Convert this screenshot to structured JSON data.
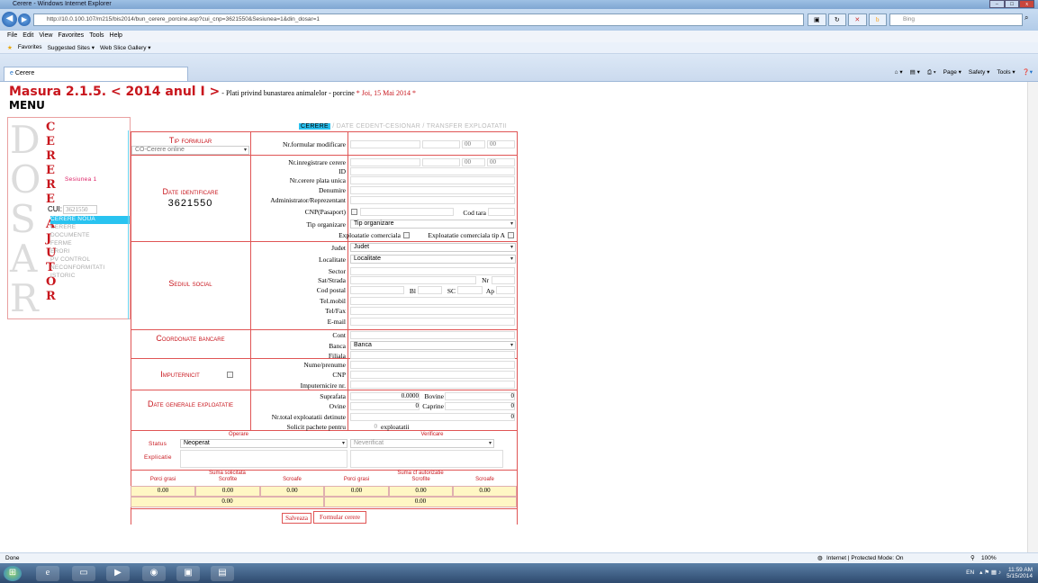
{
  "window": {
    "title": "Cerere - Windows Internet Explorer",
    "url": "http://10.0.100.107/m215/bis2014/bun_cerere_porcine.asp?cui_cnp=3621550&Sesiunea=1&din_dosar=1",
    "search_placeholder": "Bing"
  },
  "menubar": [
    "File",
    "Edit",
    "View",
    "Favorites",
    "Tools",
    "Help"
  ],
  "favbar": {
    "favorites": "Favorites",
    "suggested": "Suggested Sites ▾",
    "gallery": "Web Slice Gallery ▾"
  },
  "tab": {
    "label": "Cerere"
  },
  "cmdbar": [
    "Page ▾",
    "Safety ▾",
    "Tools ▾"
  ],
  "heading": {
    "title": "Masura 2.1.5. < 2014 anul I >",
    "subtitle": " - Plati privind bunastarea animalelor - porcine",
    "date": " * Joi, 15 Mai 2014 *"
  },
  "menu_label": "MENU",
  "sidebar": {
    "big_letters": [
      "D",
      "O",
      "S",
      "A",
      "R"
    ],
    "red_letters": [
      "C",
      "E",
      "R",
      "E",
      "R",
      "E",
      "A",
      "J",
      "U",
      "T",
      "O",
      "R"
    ],
    "session": "Sesiunea 1",
    "cui_label": "CUI:",
    "cui_value": "3621550",
    "items": [
      "CERERE NOUA",
      "CERERE",
      "DOCUMENTE",
      "FERME",
      "ERORI",
      "PV CONTROL",
      "NECONFORMITATI",
      "ISTORIC"
    ]
  },
  "tabs": {
    "active": "CERERE",
    "rest": " / DATE CEDENT-CESIONAR / TRANSFER EXPLOATATII"
  },
  "sections": {
    "tip_formular": "Tip formular",
    "date_identificare": "Date identificare",
    "cui": "3621550",
    "sediul": "Sediul social",
    "coordonate": "Coordonate bancare",
    "imputernicit": "Imputernicit",
    "date_generale": "Date generale exploatatie"
  },
  "tip_formular_value": "CO-Cerere online",
  "labels": {
    "nr_formular": "Nr.formular modificare",
    "nr_inreg": "Nr.inregistrare cerere",
    "id": "ID",
    "nr_plata": "Nr.cerere plata unica",
    "denumire": "Denumire",
    "admin": "Administrator/Reprezentant",
    "cnp_pasaport": "CNP(Pasaport)",
    "cod_tara": "Cod tara",
    "tip_org": "Tip organizare",
    "expl_com": "Exploatatie comerciala",
    "expl_com_a": "Exploatatie comerciala tip A",
    "judet": "Judet",
    "localitate": "Localitate",
    "sector": "Sector",
    "sat": "Sat/Strada",
    "nr": "Nr",
    "cod_postal": "Cod postal",
    "bl": "Bl",
    "sc": "SC",
    "ap": "Ap",
    "tel_mobil": "Tel.mobil",
    "tel_fax": "Tel/Fax",
    "email": "E-mail",
    "cont": "Cont",
    "banca": "Banca",
    "filiala": "Filiala",
    "nume": "Nume/prenume",
    "cnp": "CNP",
    "imp_nr": "Imputernicire nr.",
    "suprafata": "Suprafata",
    "bovine": "Bovine",
    "ovine": "Ovine",
    "caprine": "Caprine",
    "nr_total": "Nr.total exploatatii detinute",
    "solicit": "Solicit pachete pentru",
    "exploatatii": "exploatatii"
  },
  "fields": {
    "date_placeholder": "00",
    "sep": "/",
    "colon": ":",
    "tip_org_value": "Tip organizare",
    "judet_value": "Judet",
    "localitate_value": "Localitate",
    "banca_value": "Banca",
    "suprafata": "0.0000",
    "bovine": "0",
    "ovine": "0",
    "caprine": "0",
    "nr_total": "0",
    "solicit": "0"
  },
  "status": {
    "operare": "Operare",
    "verificare": "Verificare",
    "status_label": "Status",
    "explicatie_label": "Explicatie",
    "status_value": "Neoperat",
    "verificare_value": "Neverificat"
  },
  "suma": {
    "solicitata": "Suma solicitata",
    "autorizatie": "Suma cf autorizatie",
    "cols": [
      "Porci grasi",
      "Scrofite",
      "Scroafe",
      "Porci grasi",
      "Scrofite",
      "Scroafe"
    ],
    "row1": [
      "0.00",
      "0.00",
      "0.00",
      "0.00",
      "0.00",
      "0.00"
    ],
    "total_left": "0.00",
    "total_right": "0.00"
  },
  "buttons": {
    "salveaza": "Salveaza",
    "formular": "Formular cerere"
  },
  "statusbar": {
    "left": "Done",
    "zone": "Internet | Protected Mode: On",
    "zoom": "100%"
  },
  "tray": {
    "lang": "EN",
    "time": "11:59 AM",
    "date": "5/15/2014"
  }
}
